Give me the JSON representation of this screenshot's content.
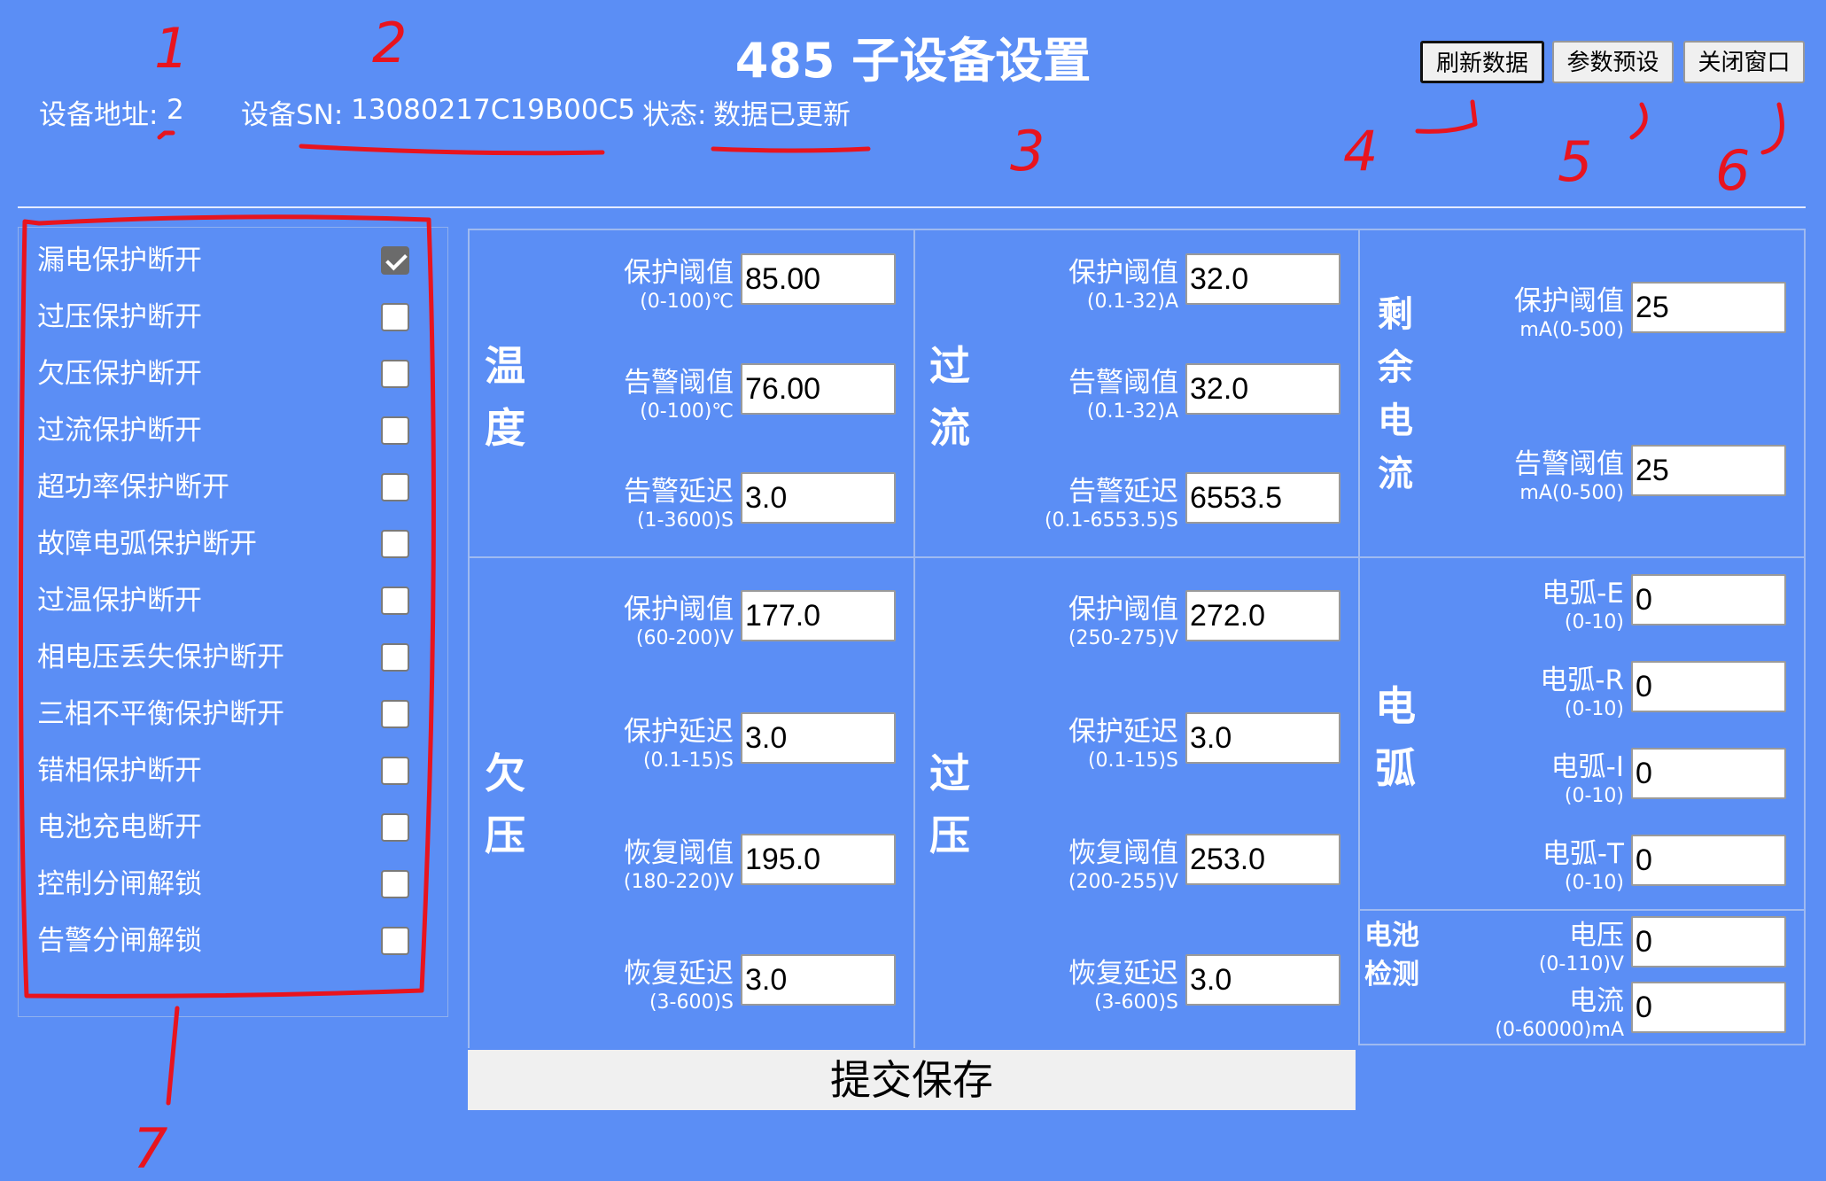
{
  "header": {
    "title": "485 子设备设置",
    "addr_label": "设备地址:",
    "addr_value": "2",
    "sn_label": "设备SN:",
    "sn_value": "13080217C19B00C5",
    "status_label": "状态:",
    "status_value": "数据已更新"
  },
  "buttons": {
    "refresh": "刷新数据",
    "preset": "参数预设",
    "close": "关闭窗口",
    "submit": "提交保存"
  },
  "checkboxes": [
    {
      "label": "漏电保护断开",
      "checked": true
    },
    {
      "label": "过压保护断开",
      "checked": false
    },
    {
      "label": "欠压保护断开",
      "checked": false
    },
    {
      "label": "过流保护断开",
      "checked": false
    },
    {
      "label": "超功率保护断开",
      "checked": false
    },
    {
      "label": "故障电弧保护断开",
      "checked": false
    },
    {
      "label": "过温保护断开",
      "checked": false
    },
    {
      "label": "相电压丢失保护断开",
      "checked": false
    },
    {
      "label": "三相不平衡保护断开",
      "checked": false
    },
    {
      "label": "错相保护断开",
      "checked": false
    },
    {
      "label": "电池充电断开",
      "checked": false
    },
    {
      "label": "控制分闸解锁",
      "checked": false
    },
    {
      "label": "告警分闸解锁",
      "checked": false
    }
  ],
  "sections": {
    "temp": {
      "t1": "温",
      "t2": "度",
      "fields": [
        {
          "label": "保护阈值",
          "range": "(0-100)℃",
          "value": "85.00"
        },
        {
          "label": "告警阈值",
          "range": "(0-100)℃",
          "value": "76.00"
        },
        {
          "label": "告警延迟",
          "range": "(1-3600)S",
          "value": "3.0"
        }
      ]
    },
    "overcurrent": {
      "t1": "过",
      "t2": "流",
      "fields": [
        {
          "label": "保护阈值",
          "range": "(0.1-32)A",
          "value": "32.0"
        },
        {
          "label": "告警阈值",
          "range": "(0.1-32)A",
          "value": "32.0"
        },
        {
          "label": "告警延迟",
          "range": "(0.1-6553.5)S",
          "value": "6553.5"
        }
      ]
    },
    "residual": {
      "t1": "剩",
      "t2": "余",
      "t3": "电",
      "t4": "流",
      "fields": [
        {
          "label": "保护阈值",
          "range": "mA(0-500)",
          "value": "25"
        },
        {
          "label": "告警阈值",
          "range": "mA(0-500)",
          "value": "25"
        }
      ]
    },
    "undervoltage": {
      "t1": "欠",
      "t2": "压",
      "fields": [
        {
          "label": "保护阈值",
          "range": "(60-200)V",
          "value": "177.0"
        },
        {
          "label": "保护延迟",
          "range": "(0.1-15)S",
          "value": "3.0"
        },
        {
          "label": "恢复阈值",
          "range": "(180-220)V",
          "value": "195.0"
        },
        {
          "label": "恢复延迟",
          "range": "(3-600)S",
          "value": "3.0"
        }
      ]
    },
    "overvoltage": {
      "t1": "过",
      "t2": "压",
      "fields": [
        {
          "label": "保护阈值",
          "range": "(250-275)V",
          "value": "272.0"
        },
        {
          "label": "保护延迟",
          "range": "(0.1-15)S",
          "value": "3.0"
        },
        {
          "label": "恢复阈值",
          "range": "(200-255)V",
          "value": "253.0"
        },
        {
          "label": "恢复延迟",
          "range": "(3-600)S",
          "value": "3.0"
        }
      ]
    },
    "arc": {
      "t1": "电",
      "t2": "弧",
      "fields": [
        {
          "label": "电弧-E",
          "range": "(0-10)",
          "value": "0"
        },
        {
          "label": "电弧-R",
          "range": "(0-10)",
          "value": "0"
        },
        {
          "label": "电弧-I",
          "range": "(0-10)",
          "value": "0"
        },
        {
          "label": "电弧-T",
          "range": "(0-10)",
          "value": "0"
        }
      ]
    },
    "battery": {
      "t1": "电池",
      "t2": "检测",
      "fields": [
        {
          "label": "电压",
          "range": "(0-110)V",
          "value": "0"
        },
        {
          "label": "电流",
          "range": "(0-60000)mA",
          "value": "0"
        }
      ]
    }
  },
  "annotations": {
    "n1": "1",
    "n2": "2",
    "n3": "3",
    "n4": "4",
    "n5": "5",
    "n6": "6",
    "n7": "7",
    "color": "#e8141e"
  }
}
